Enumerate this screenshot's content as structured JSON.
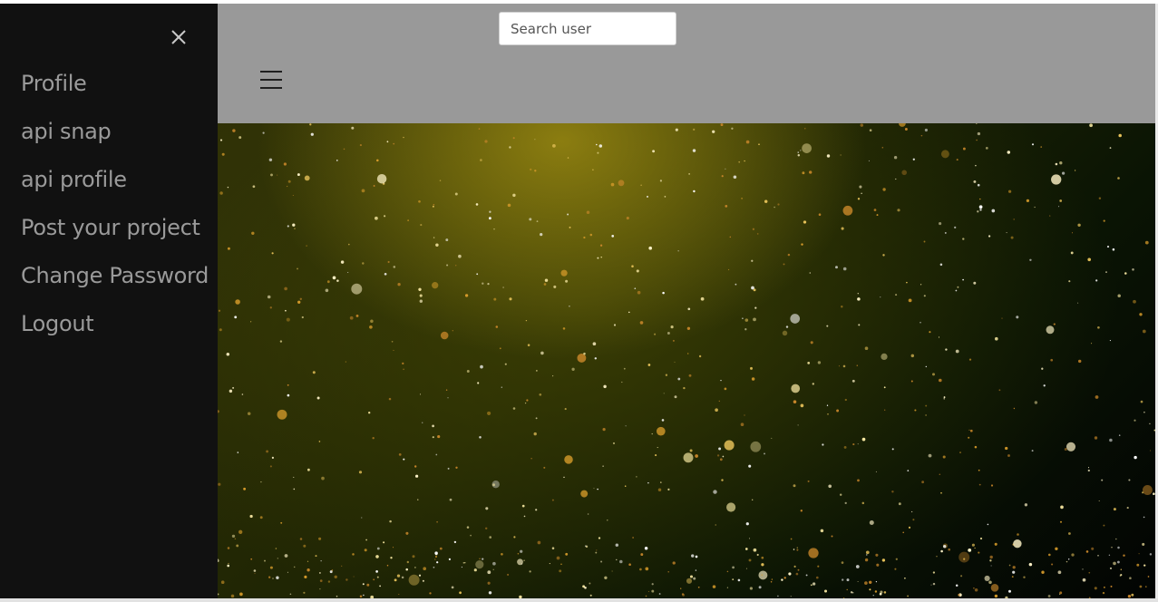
{
  "sidebar": {
    "close_icon": "close-icon",
    "items": [
      {
        "label": "Profile"
      },
      {
        "label": "api snap"
      },
      {
        "label": "api profile"
      },
      {
        "label": "Post your project"
      },
      {
        "label": "Change Password"
      },
      {
        "label": "Logout"
      }
    ]
  },
  "header": {
    "search": {
      "placeholder": "Search user",
      "value": ""
    },
    "menu_icon": "hamburger-menu-icon"
  },
  "hero": {
    "image": "gold-particle-sparkle-background"
  },
  "colors": {
    "sidebar_bg": "#111111",
    "sidebar_text": "#9a9a9a",
    "header_bg": "#999999",
    "hero_accent": "#d4a72c"
  }
}
